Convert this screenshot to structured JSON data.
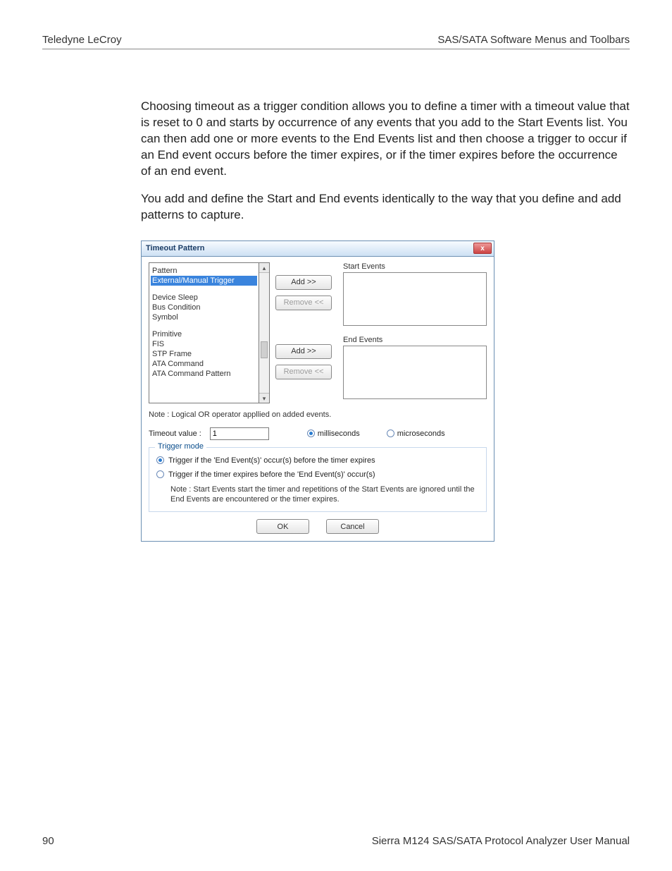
{
  "header": {
    "left": "Teledyne LeCroy",
    "right": "SAS/SATA Software Menus and Toolbars"
  },
  "paras": [
    "Choosing timeout as a trigger condition allows you to define a timer with a timeout value that is reset to 0 and starts by occurrence of any events that you add to the Start Events list. You can then add one or more events to the End Events list and then choose a trigger to occur if an End event occurs before the timer expires, or if the timer expires before the occurrence of an end event.",
    "You add and define the Start and End events identically to the way that you define and add patterns to capture."
  ],
  "dialog": {
    "title": "Timeout Pattern",
    "close": "x",
    "left_list": [
      {
        "label": "Pattern",
        "sel": false
      },
      {
        "label": "External/Manual Trigger",
        "sel": true
      },
      {
        "gap": true
      },
      {
        "label": "Device Sleep",
        "sel": false
      },
      {
        "label": "Bus Condition",
        "sel": false
      },
      {
        "label": "Symbol",
        "sel": false
      },
      {
        "gap": true
      },
      {
        "label": "Primitive",
        "sel": false
      },
      {
        "label": "FIS",
        "sel": false
      },
      {
        "label": "STP Frame",
        "sel": false
      },
      {
        "label": "ATA Command",
        "sel": false
      },
      {
        "label": "ATA Command Pattern",
        "sel": false
      }
    ],
    "btn_add": "Add >>",
    "btn_remove": "Remove <<",
    "start_events_label": "Start Events",
    "end_events_label": "End Events",
    "note1": "Note : Logical OR operator appllied on added events.",
    "timeout_label": "Timeout value :",
    "timeout_value": "1",
    "unit_ms": "milliseconds",
    "unit_us": "microseconds",
    "trigger_mode_label": "Trigger mode",
    "opt1": "Trigger if the 'End Event(s)' occur(s) before the timer expires",
    "opt2": "Trigger if the timer expires before the 'End Event(s)' occur(s)",
    "note2": "Note : Start Events start the timer and repetitions of the Start Events are ignored until the End Events are encountered or the timer expires.",
    "ok": "OK",
    "cancel": "Cancel"
  },
  "footer": {
    "page": "90",
    "manual": "Sierra M124 SAS/SATA Protocol Analyzer User Manual"
  }
}
